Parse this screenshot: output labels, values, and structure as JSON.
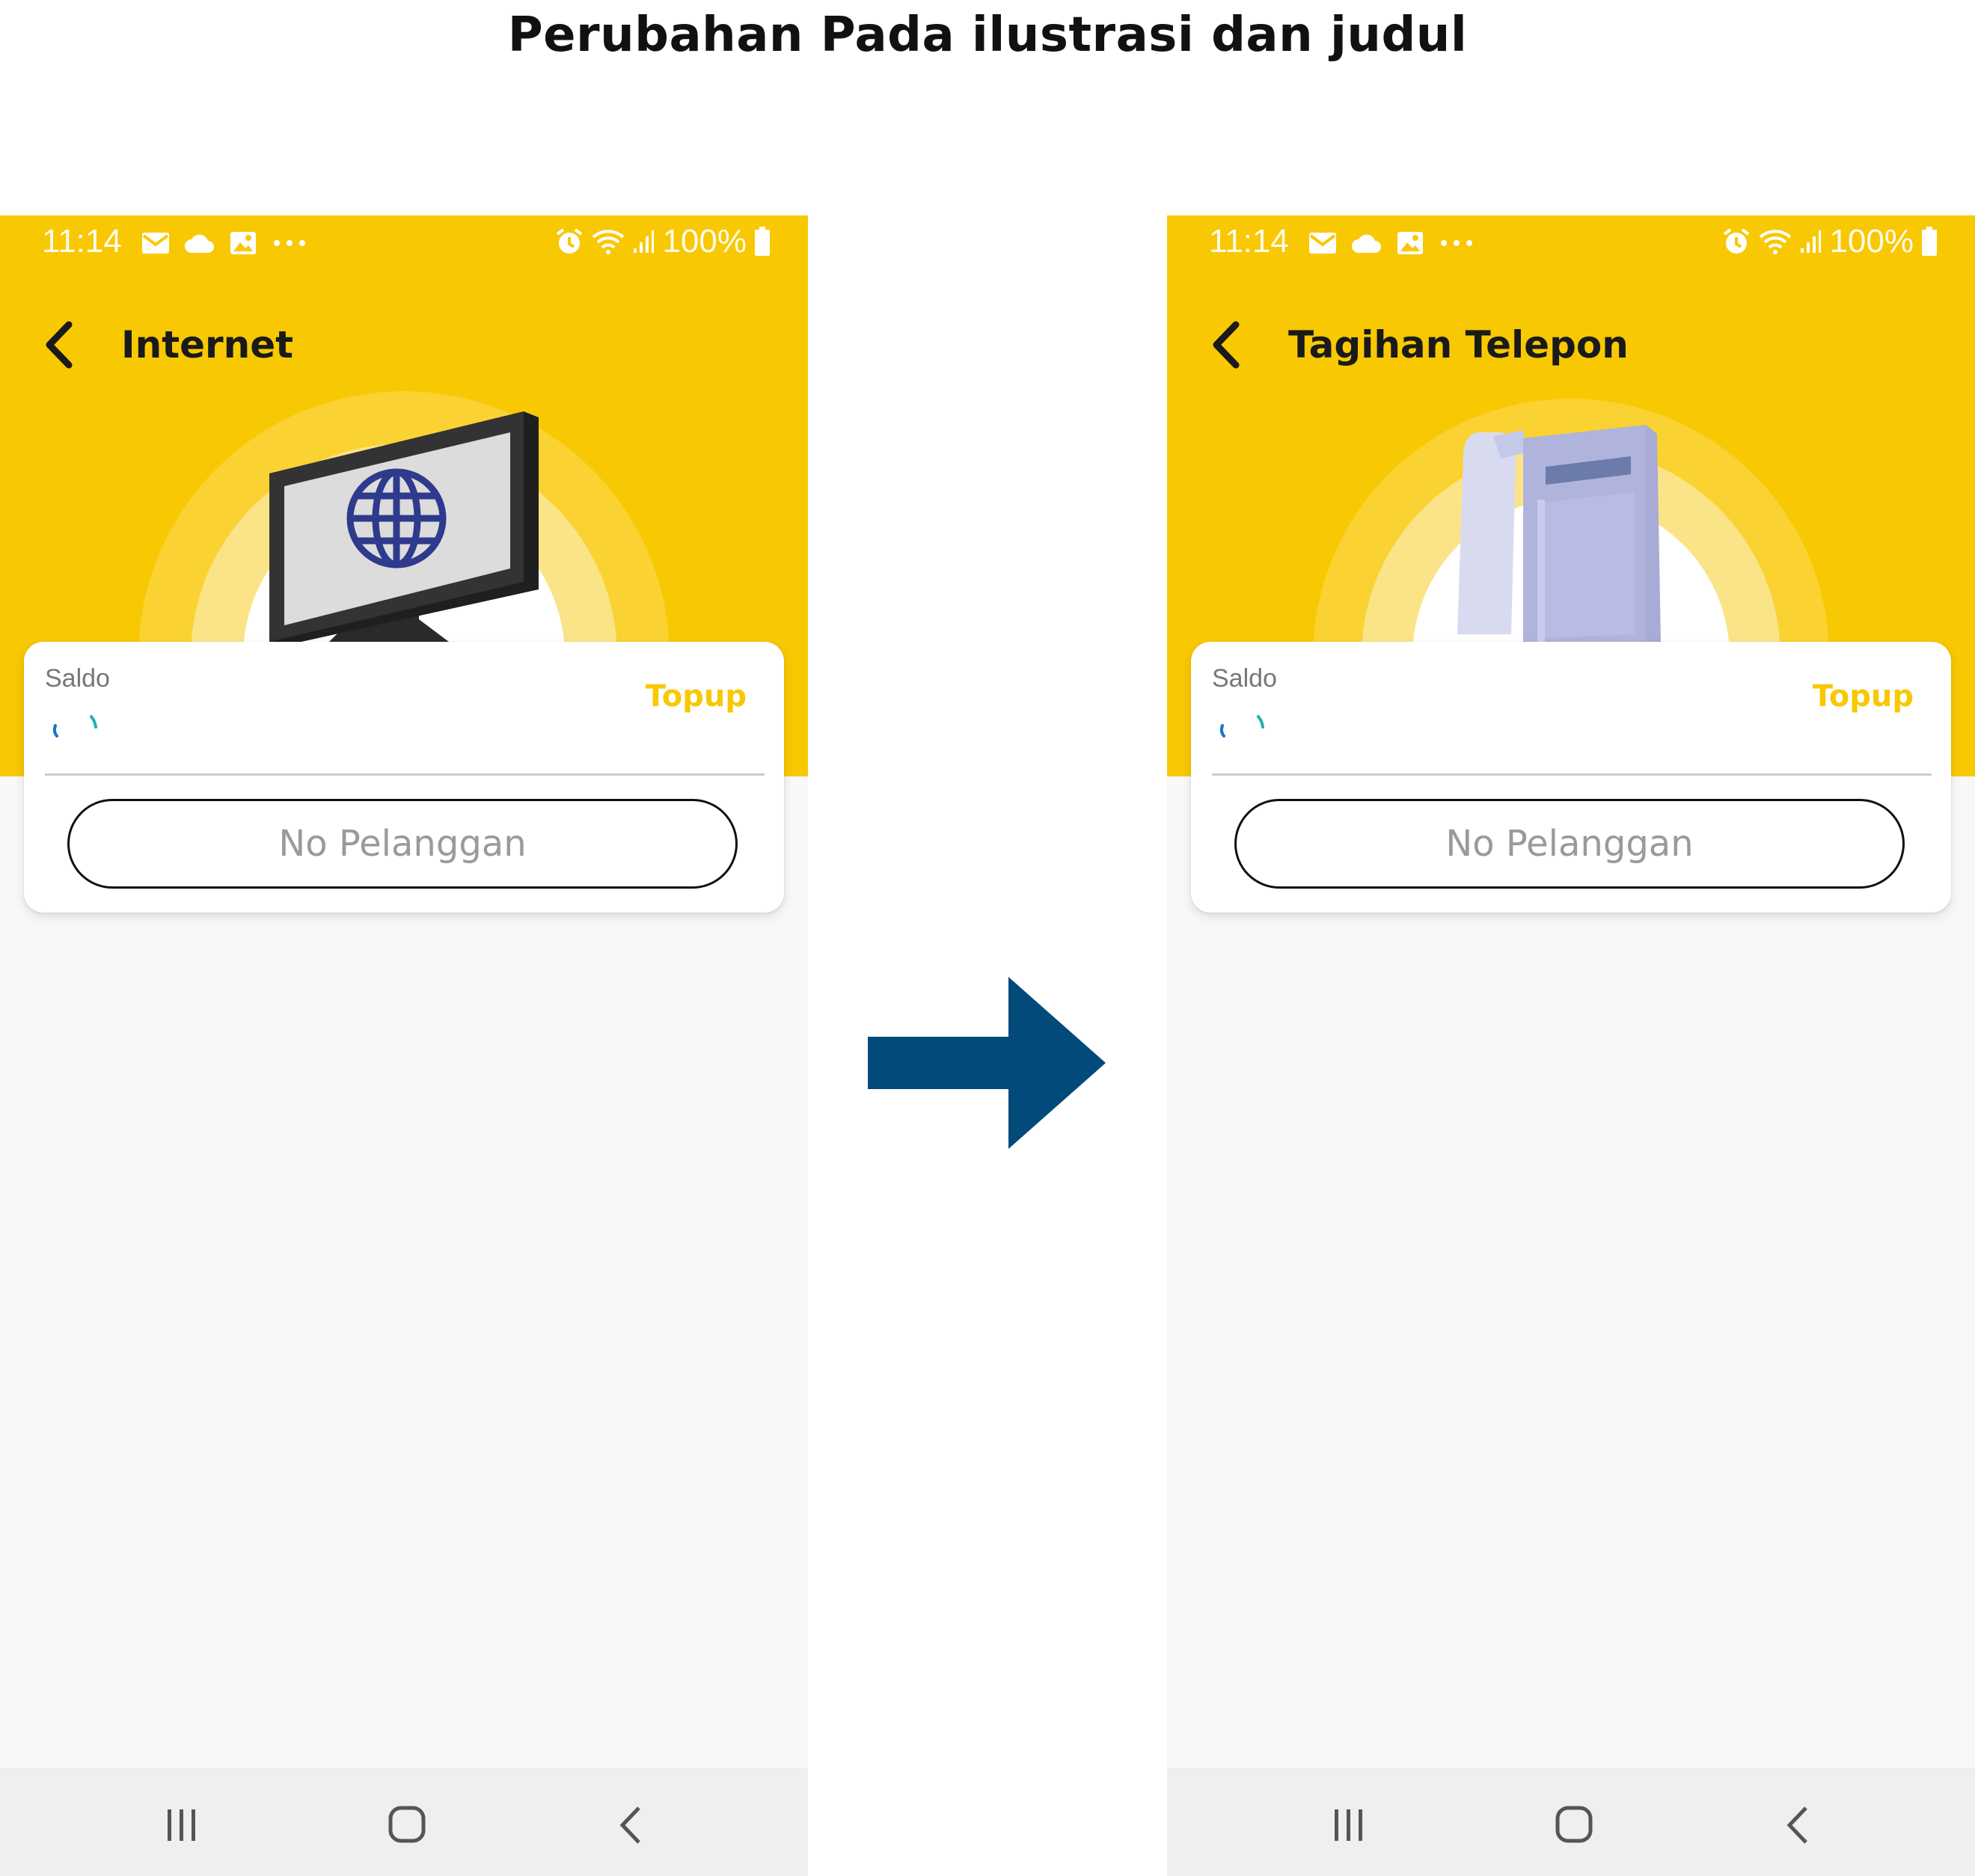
{
  "heading": "Perubahan Pada ilustrasi dan judul",
  "colors": {
    "brand_yellow": "#f8c803",
    "arrow": "#024a7a",
    "globe": "#2e3a8c",
    "phone_body": "#b0b3dc"
  },
  "screens": [
    {
      "status_bar": {
        "time": "11:14",
        "battery": "100%"
      },
      "title": "Internet",
      "illustration": "computer-monitor-globe",
      "card": {
        "saldo_label": "Saldo",
        "topup_label": "Topup",
        "customer_placeholder": "No Pelanggan"
      }
    },
    {
      "status_bar": {
        "time": "11:14",
        "battery": "100%"
      },
      "title": "Tagihan Telepon",
      "illustration": "desk-telephone",
      "card": {
        "saldo_label": "Saldo",
        "topup_label": "Topup",
        "customer_placeholder": "No Pelanggan"
      }
    }
  ],
  "icons": {
    "status_left": [
      "email-icon",
      "cloud-icon",
      "image-icon",
      "more-dots-icon"
    ],
    "status_right": [
      "alarm-icon",
      "wifi-icon",
      "signal-icon",
      "battery-icon"
    ],
    "nav": [
      "recent-apps-icon",
      "home-icon",
      "back-icon"
    ],
    "transition": "arrow-right-icon"
  }
}
